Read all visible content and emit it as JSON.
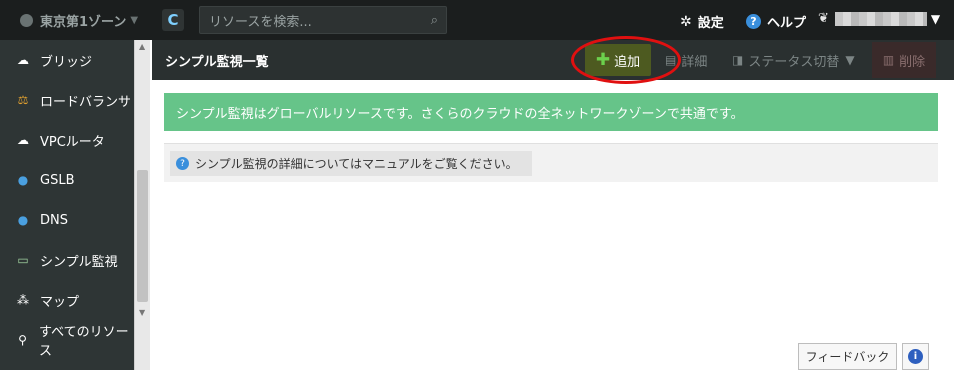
{
  "header": {
    "zone_label": "東京第1ゾーン",
    "search_placeholder": "リソースを検索...",
    "settings_label": "設定",
    "help_label": "ヘルプ"
  },
  "sidebar": {
    "items": [
      {
        "label": "ブリッジ",
        "icon": "bridge-icon"
      },
      {
        "label": "ロードバランサ",
        "icon": "load-balancer-icon"
      },
      {
        "label": "VPCルータ",
        "icon": "vpc-router-icon"
      },
      {
        "label": "GSLB",
        "icon": "gslb-icon"
      },
      {
        "label": "DNS",
        "icon": "dns-icon"
      },
      {
        "label": "シンプル監視",
        "icon": "monitor-icon"
      },
      {
        "label": "マップ",
        "icon": "map-icon"
      },
      {
        "label": "すべてのリソース",
        "icon": "search-icon"
      }
    ]
  },
  "toolbar": {
    "title": "シンプル監視一覧",
    "add_label": "追加",
    "detail_label": "詳細",
    "status_label": "ステータス切替",
    "delete_label": "削除"
  },
  "main": {
    "notice": "シンプル監視はグローバルリソースです。さくらのクラウドの全ネットワークゾーンで共通です。",
    "info": "シンプル監視の詳細についてはマニュアルをご覧ください。"
  },
  "footer": {
    "feedback_label": "フィードバック"
  },
  "colors": {
    "topbar": "#1b1e1e",
    "sidebar": "#2e3535",
    "notice_green": "#66c489",
    "add_button": "#4d5a20",
    "callout_red": "#e01010"
  }
}
